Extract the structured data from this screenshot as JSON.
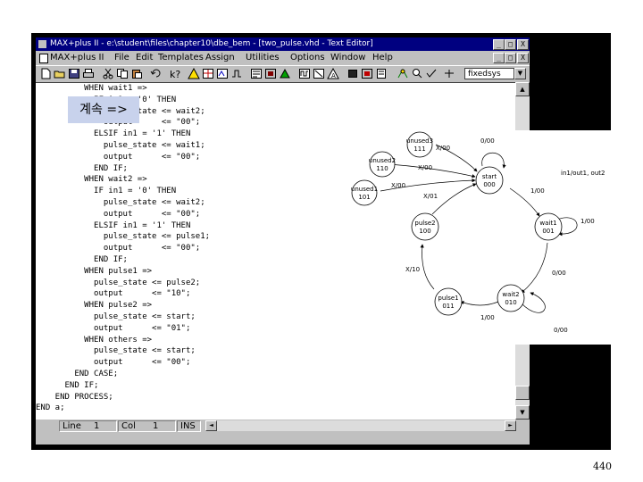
{
  "window": {
    "title": "MAX+plus II - e:\\student\\files\\chapter10\\dbe_bem - [two_pulse.vhd - Text Editor]",
    "minimize": "_",
    "restore": "□",
    "close": "X",
    "doc_minimize": "_",
    "doc_restore": "□",
    "doc_close": "X"
  },
  "menu": {
    "items": [
      "MAX+plus II",
      "File",
      "Edit",
      "Templates",
      "Assign",
      "Utilities",
      "Options",
      "Window",
      "Help"
    ]
  },
  "toolbar": {
    "buttons": [
      "new-icon",
      "open-icon",
      "save-icon",
      "print-icon",
      "cut-icon",
      "copy-icon",
      "paste-icon",
      "undo-icon",
      "help-icon",
      "hierarchy-icon",
      "floorplan-icon",
      "compiler-icon",
      "simulator-icon",
      "timing-icon",
      "programmer-icon",
      "project-icon"
    ],
    "font_value": "fixedsys",
    "font_arrow": "▼"
  },
  "editor": {
    "code_lines": [
      "          WHEN wait1 =>",
      "            IF in1 = '0' THEN",
      "              pulse_state <= wait2;",
      "              output      <= \"00\";",
      "            ELSIF in1 = '1' THEN",
      "              pulse_state <= wait1;",
      "              output      <= \"00\";",
      "            END IF;",
      "          WHEN wait2 =>",
      "            IF in1 = '0' THEN",
      "              pulse_state <= wait2;",
      "              output      <= \"00\";",
      "            ELSIF in1 = '1' THEN",
      "              pulse_state <= pulse1;",
      "              output      <= \"00\";",
      "            END IF;",
      "          WHEN pulse1 =>",
      "            pulse_state <= pulse2;",
      "            output      <= \"10\";",
      "          WHEN pulse2 =>",
      "            pulse_state <= start;",
      "            output      <= \"01\";",
      "          WHEN others =>",
      "            pulse_state <= start;",
      "            output      <= \"00\";",
      "        END CASE;",
      "      END IF;",
      "    END PROCESS;",
      "END a;"
    ],
    "scroll_up": "▲",
    "scroll_down": "▼"
  },
  "status": {
    "line_label": "Line",
    "line_value": "1",
    "col_label": "Col",
    "col_value": "1",
    "mode": "INS",
    "hscroll_left": "◄",
    "hscroll_right": "►"
  },
  "overlay": {
    "continue_label": "계속 =>"
  },
  "diagram": {
    "states": [
      {
        "id": "unused3",
        "name": "unused3",
        "code": "111"
      },
      {
        "id": "unused2",
        "name": "unused2",
        "code": "110"
      },
      {
        "id": "unused1",
        "name": "unused1",
        "code": "101"
      },
      {
        "id": "start",
        "name": "start",
        "code": "000"
      },
      {
        "id": "pulse2",
        "name": "pulse2",
        "code": "100"
      },
      {
        "id": "wait1",
        "name": "wait1",
        "code": "001"
      },
      {
        "id": "pulse1",
        "name": "pulse1",
        "code": "011"
      },
      {
        "id": "wait2",
        "name": "wait2",
        "code": "010"
      }
    ],
    "labels": {
      "start_self": "0/00",
      "legend": "in1/out1, out2",
      "unused3_start": "X/00",
      "unused2_start": "X/00",
      "unused1_start": "X/00",
      "pulse2_start": "X/01",
      "start_wait1": "1/00",
      "wait1_self": "1/00",
      "wait1_wait2": "0/00",
      "wait2_self": "0/00",
      "wait2_pulse1": "1/00",
      "pulse1_pulse2": "X/10"
    }
  },
  "page": {
    "number": "440"
  }
}
